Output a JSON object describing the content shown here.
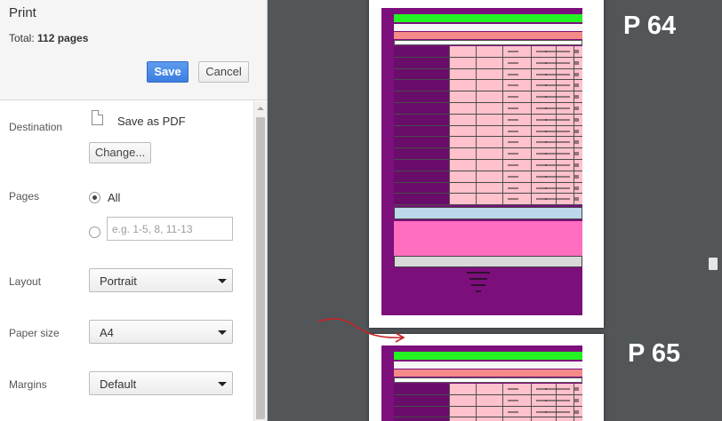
{
  "header": {
    "title": "Print",
    "total_label": "Total: ",
    "total_value": "112 pages",
    "save_label": "Save",
    "cancel_label": "Cancel"
  },
  "destination": {
    "label": "Destination",
    "value": "Save as PDF",
    "change_label": "Change..."
  },
  "pages": {
    "label": "Pages",
    "all_label": "All",
    "selected": "All",
    "custom_value": "",
    "custom_placeholder": "e.g. 1-5, 8, 11-13"
  },
  "layout": {
    "label": "Layout",
    "value": "Portrait"
  },
  "paper_size": {
    "label": "Paper size",
    "value": "A4"
  },
  "margins": {
    "label": "Margins",
    "value": "Default"
  },
  "preview": {
    "pages": [
      {
        "label": "P 64"
      },
      {
        "label": "P 65"
      }
    ]
  },
  "colors": {
    "save_button": "#4787ed",
    "preview_background": "#525659",
    "sheet_fill": "#7c0f7c",
    "header_bar": "#23f323",
    "highlight_row": "#ff6ebf",
    "annotation_arrow": "#c62222"
  }
}
